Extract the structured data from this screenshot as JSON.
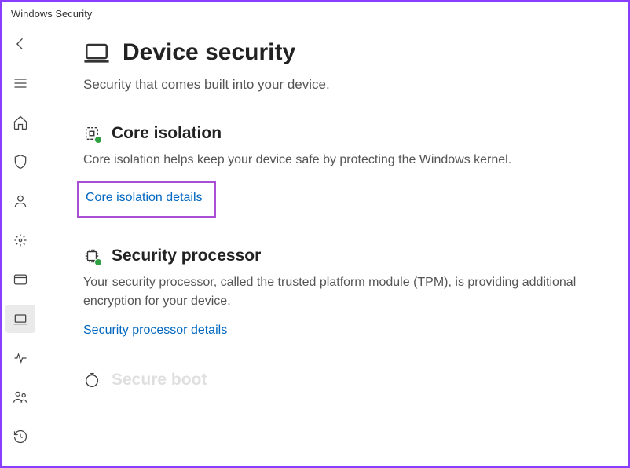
{
  "window": {
    "title": "Windows Security"
  },
  "page": {
    "title": "Device security",
    "subtitle": "Security that comes built into your device."
  },
  "sections": {
    "core_isolation": {
      "title": "Core isolation",
      "desc": "Core isolation helps keep your device safe by protecting the Windows kernel.",
      "link": "Core isolation details"
    },
    "security_processor": {
      "title": "Security processor",
      "desc": "Your security processor, called the trusted platform module (TPM), is providing additional encryption for your device.",
      "link": "Security processor details"
    },
    "secure_boot": {
      "title": "Secure boot"
    }
  }
}
